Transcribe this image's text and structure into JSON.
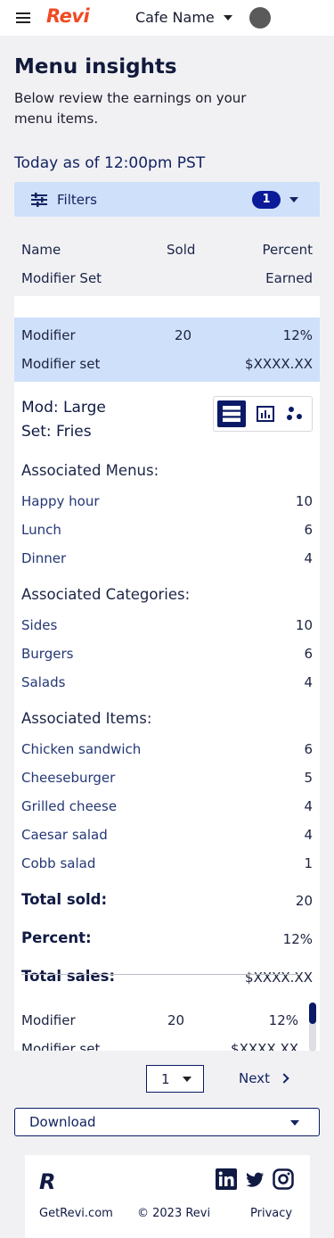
{
  "header": {
    "logo": "Revi",
    "cafe_name": "Cafe Name"
  },
  "page": {
    "title": "Menu insights",
    "subtitle": "Below review the earnings on your menu items.",
    "as_of": "Today as of 12:00pm PST"
  },
  "filters": {
    "label": "Filters",
    "count": "1"
  },
  "table_header": {
    "name": "Name",
    "sold": "Sold",
    "percent": "Percent",
    "modifier_set": "Modifier Set",
    "earned": "Earned"
  },
  "selected_row": {
    "name": "Modifier",
    "sold": "20",
    "percent": "12%",
    "set": "Modifier set",
    "earned": "$XXXX.XX"
  },
  "detail": {
    "mod": "Mod: Large",
    "set": "Set: Fries",
    "menus_title": "Associated Menus:",
    "menus": [
      {
        "name": "Happy hour",
        "count": "10"
      },
      {
        "name": "Lunch",
        "count": "6"
      },
      {
        "name": "Dinner",
        "count": "4"
      }
    ],
    "categories_title": "Associated Categories:",
    "categories": [
      {
        "name": "Sides",
        "count": "10"
      },
      {
        "name": "Burgers",
        "count": "6"
      },
      {
        "name": "Salads",
        "count": "4"
      }
    ],
    "items_title": "Associated Items:",
    "items": [
      {
        "name": "Chicken sandwich",
        "count": "6"
      },
      {
        "name": "Cheeseburger",
        "count": "5"
      },
      {
        "name": "Grilled cheese",
        "count": "4"
      },
      {
        "name": "Caesar salad",
        "count": "4"
      },
      {
        "name": "Cobb salad",
        "count": "1"
      }
    ],
    "total_sold_label": "Total sold:",
    "total_sold": "20",
    "percent_label": "Percent:",
    "percent": "12%",
    "total_sales_label": "Total sales:",
    "total_sales": "$XXXX.XX"
  },
  "next_row": {
    "name": "Modifier",
    "sold": "20",
    "percent": "12%",
    "set": "Modifier set",
    "earned": "$XXXX.XX"
  },
  "pagination": {
    "page": "1",
    "next": "Next"
  },
  "download": {
    "label": "Download"
  },
  "footer": {
    "logo": "R",
    "site": "GetRevi.com",
    "copyright": "© 2023 Revi",
    "privacy": "Privacy"
  },
  "colors": {
    "brand": "#f04a23",
    "navy": "#0a1a66",
    "highlight": "#cfe0fb",
    "badge": "#0a1a99"
  },
  "icons": [
    "menu-icon",
    "avatar",
    "filter-sliders-icon",
    "chevron-down-icon",
    "list-view-icon",
    "bar-chart-icon",
    "scatter-icon",
    "chevron-right-icon",
    "linkedin-icon",
    "twitter-icon",
    "instagram-icon"
  ]
}
